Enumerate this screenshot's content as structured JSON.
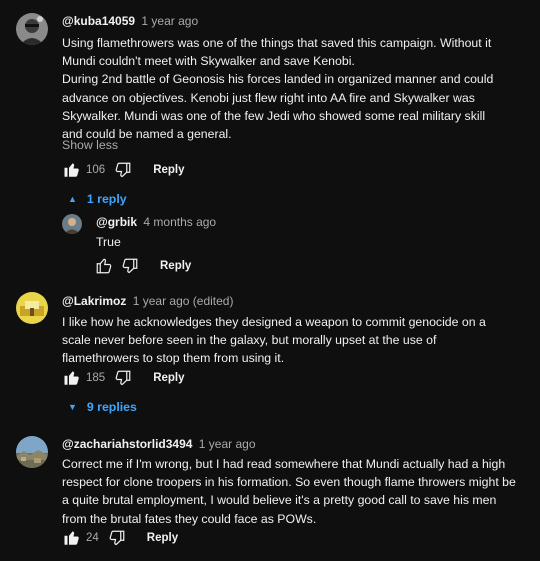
{
  "comments": [
    {
      "author": "@kuba14059",
      "time": "1 year ago",
      "lines": [
        "Using flamethrowers was one of the things that saved this campaign. Without it Mundi couldn't meet with Skywalker and save Kenobi.",
        "During 2nd battle of Geonosis his forces landed in organized manner and could advance on objectives. Kenobi just flew right into AA fire and Skywalker was Skywalker. Mundi was one of the few Jedi who showed some real military skill and could be named a general."
      ],
      "show_less": "Show less",
      "likes": "106",
      "reply_label": "Reply",
      "replies_toggle": "1 reply"
    },
    {
      "author": "@grbik",
      "time": "4 months ago",
      "text": "True",
      "reply_label": "Reply"
    },
    {
      "author": "@Lakrimoz",
      "time": "1 year ago (edited)",
      "text": "I like how he acknowledges they designed a weapon to commit genocide on a scale never before seen in the galaxy, but morally upset at the use of flamethrowers to stop them from using it.",
      "likes": "185",
      "reply_label": "Reply",
      "replies_toggle": "9 replies"
    },
    {
      "author": "@zachariahstorlid3494",
      "time": "1 year ago",
      "text": "Correct me if I'm wrong, but I had read somewhere that Mundi actually had a high respect for clone troopers in his formation. So even though flame throwers might be a quite brutal employment, I would believe it's a pretty good call to save his men from the brutal fates they could face as POWs.",
      "likes": "24",
      "reply_label": "Reply"
    }
  ],
  "colors": {
    "background": "#0f0f0f",
    "text": "#f1f1f1",
    "secondary": "#aaaaaa",
    "link": "#3ea6ff"
  },
  "icons": [
    "like-filled-icon",
    "dislike-icon",
    "like-outline-icon",
    "caret-up-icon",
    "caret-down-icon"
  ]
}
